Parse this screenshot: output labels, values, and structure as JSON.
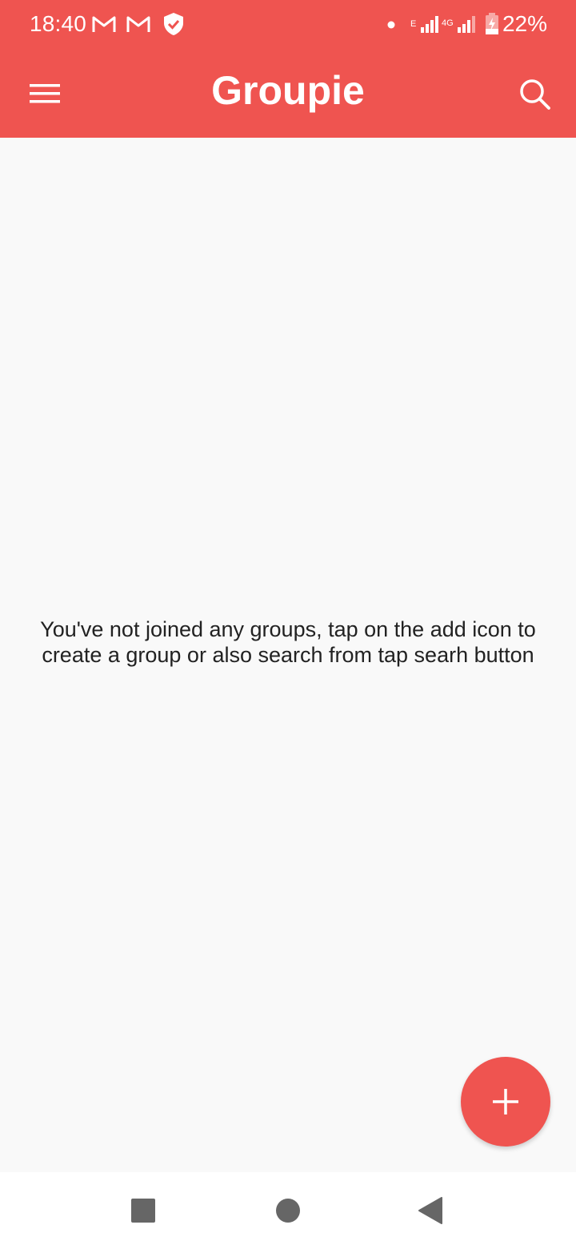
{
  "status_bar": {
    "time": "18:40",
    "battery": "22%",
    "icons": [
      "gmail-icon",
      "gmail-icon",
      "shield-icon",
      "dot-icon",
      "signal-icon",
      "signal-4g-icon",
      "battery-charging-icon"
    ],
    "network_e_label": "E",
    "network_4g_label": "4G"
  },
  "app_bar": {
    "title": "Groupie",
    "menu_icon": "hamburger-menu-icon",
    "search_icon": "search-icon"
  },
  "main": {
    "empty_message": "You've not joined any groups, tap on the add icon to create a group or also search from tap searh button"
  },
  "fab": {
    "icon": "plus-icon"
  },
  "nav_bar": {
    "buttons": [
      "recents-square-icon",
      "home-circle-icon",
      "back-triangle-icon"
    ]
  },
  "colors": {
    "accent": "#ef5450",
    "background": "#f9f9f9",
    "text": "#222222",
    "nav_icon": "#666666"
  }
}
